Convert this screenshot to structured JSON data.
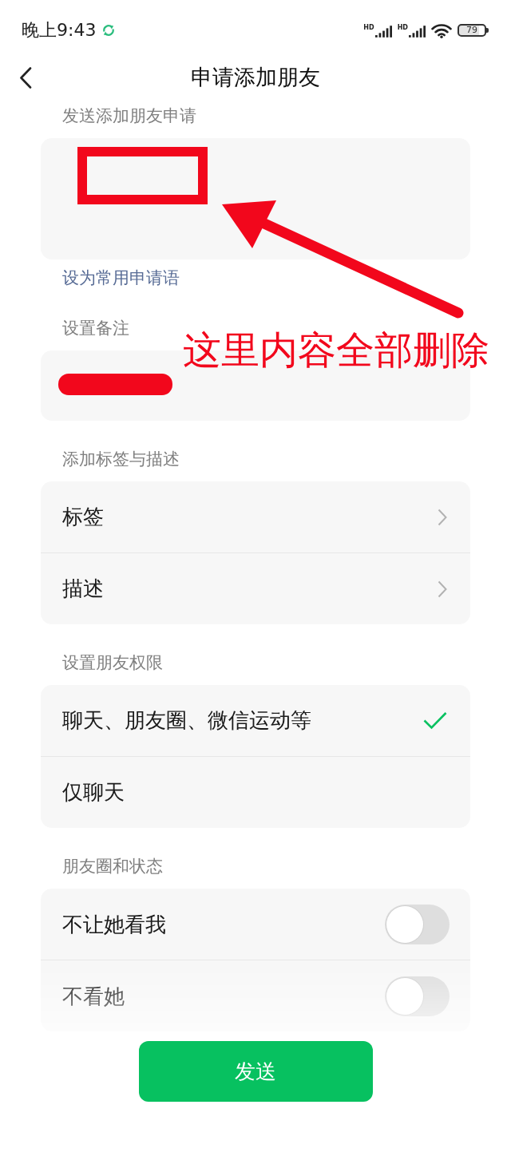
{
  "status_bar": {
    "time": "晚上9:43",
    "signals": [
      {
        "badge": "HD"
      },
      {
        "badge": "HD"
      }
    ],
    "battery": "79"
  },
  "nav": {
    "title": "申请添加朋友"
  },
  "request_section": {
    "label": "发送添加朋友申请",
    "link": "设为常用申请语"
  },
  "remark_section": {
    "label": "设置备注",
    "value_redacted": true
  },
  "tags_section": {
    "label": "添加标签与描述",
    "items": [
      {
        "label": "标签"
      },
      {
        "label": "描述"
      }
    ]
  },
  "permission_section": {
    "label": "设置朋友权限",
    "options": [
      {
        "label": "聊天、朋友圈、微信运动等",
        "selected": true
      },
      {
        "label": "仅聊天",
        "selected": false
      }
    ]
  },
  "moments_section": {
    "label": "朋友圈和状态",
    "toggles": [
      {
        "label": "不让她看我",
        "on": false
      },
      {
        "label": "不看她",
        "on": false
      }
    ]
  },
  "send_button": {
    "label": "发送"
  },
  "annotation": {
    "text": "这里内容全部删除"
  }
}
